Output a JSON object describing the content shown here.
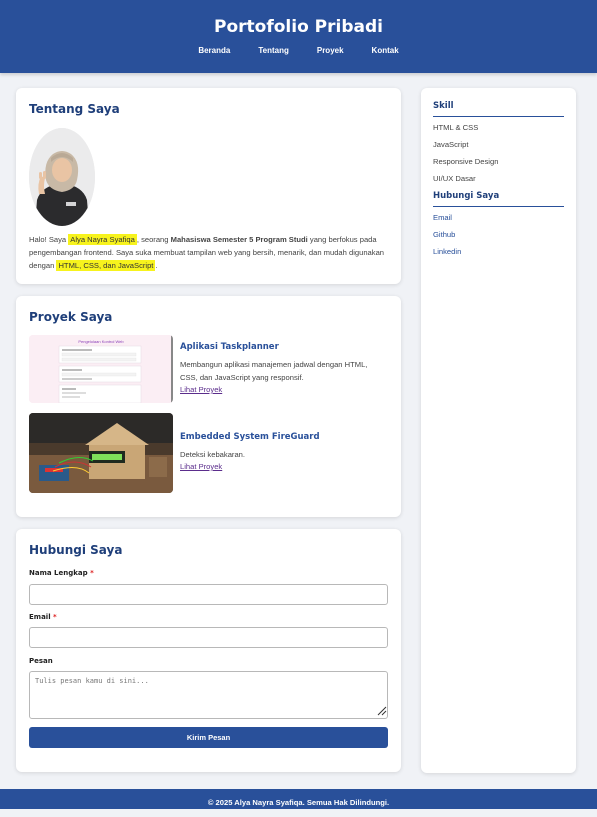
{
  "header": {
    "title": "Portofolio Pribadi",
    "nav": [
      "Beranda",
      "Tentang",
      "Proyek",
      "Kontak"
    ]
  },
  "about": {
    "title": "Tentang Saya",
    "text_1": "Halo! Saya ",
    "name": "Alya Nayra Syafiqa",
    "text_2": ", seorang ",
    "role": "Mahasiswa Semester 5 Program Studi",
    "text_3": " yang berfokus pada pengembangan frontend. Saya suka membuat tampilan web yang bersih, menarik, dan mudah digunakan dengan ",
    "skills": "HTML, CSS, dan JavaScript",
    "text_4": "."
  },
  "projects": {
    "title": "Proyek Saya",
    "items": [
      {
        "title": "Aplikasi Taskplanner",
        "desc": "Membangun aplikasi manajemen jadwal dengan HTML, CSS, dan JavaScript yang responsif.",
        "link": "Lihat Proyek",
        "thumb_title": "Pengelolaan Kontrol Web"
      },
      {
        "title": "Embedded System FireGuard",
        "desc": "Deteksi kebakaran.",
        "link": "Lihat Proyek"
      }
    ]
  },
  "contact": {
    "title": "Hubungi Saya",
    "name_label": "Nama Lengkap",
    "email_label": "Email",
    "message_label": "Pesan",
    "required_mark": "*",
    "message_placeholder": "Tulis pesan kamu di sini...",
    "submit": "Kirim Pesan"
  },
  "sidebar": {
    "skill_title": "Skill",
    "skills": [
      "HTML & CSS",
      "JavaScript",
      "Responsive Design",
      "UI/UX Dasar"
    ],
    "contact_title": "Hubungi Saya",
    "links": [
      "Email",
      "Github",
      "Linkedin"
    ]
  },
  "footer": {
    "text": "© 2025 Alya Nayra Syafiqa. Semua Hak Dilindungi."
  },
  "colors": {
    "primary": "#29509a",
    "heading": "#1f3f7a",
    "highlight": "#f7f31d",
    "background": "#f0f2f6"
  }
}
